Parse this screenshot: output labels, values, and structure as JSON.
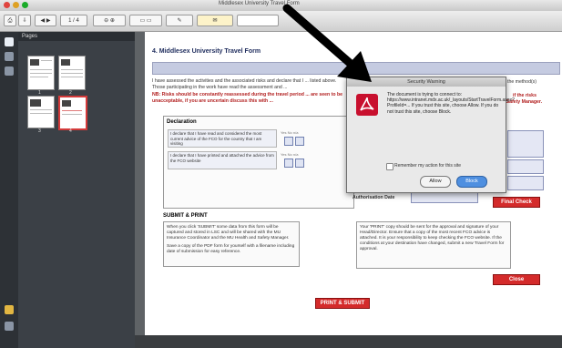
{
  "window": {
    "title": "Middlesex University Travel Form"
  },
  "document": {
    "heading": "4. Middlesex University Travel Form",
    "intro": "I have assessed the activities and the associated risks and declare that I ... listed above. Those participating in the work have read the assessment and ...",
    "warning": "NB: Risks should be constantly reassessed during the travel period ... are seen to be unacceptable, if you are uncertain discuss this with ...",
    "right_text_1": "the method(s)",
    "right_text_2": "if the risks",
    "right_text_3": "d Safety Manager.",
    "declaration_title": "Declaration",
    "decl_row1": "I declare that I have read and considered the most current advice of the FCO for the country that I am visiting",
    "decl_row2": "I declare that I have printed and attached the advice from the FCO website",
    "yn_label": "Yes  No  n/a",
    "authorisation_label": "Authorisation Date",
    "final_check": "Final Check",
    "submit_heading": "SUBMIT & PRINT",
    "submit_text1": "When you click 'SUBMIT' some data from this form will be captured and stored in LSC and will be shared with the MU Insurance Coordinator and the MU Health and Safety Manager.",
    "submit_text2": "Save a copy of the PDF form for yourself with a filename including date of submission for easy reference.",
    "print_text": "Your 'PRINT' copy should be sent for the approval and signature of your Head/Director. Ensure that a copy of the most recent FCO advice is attached. It is your responsibility to keep checking the FCO website. If the conditions at your destination have changed, submit a new Travel Form for approval.",
    "close_label": "Close",
    "print_submit": "PRINT & SUBMIT"
  },
  "dialog": {
    "title": "Security Warning",
    "message": "The document is trying to connect to: https://www.intranet.mdx.ac.uk/_layouts/StartTravelForm.aspx?ProfileId=... If you trust this site, choose Allow. If you do not trust this site, choose Block.",
    "remember": "Remember my action for this site",
    "allow": "Allow",
    "block": "Block"
  },
  "sidebar": {
    "title": "Pages",
    "pages": [
      "1",
      "2",
      "3",
      "4"
    ]
  }
}
